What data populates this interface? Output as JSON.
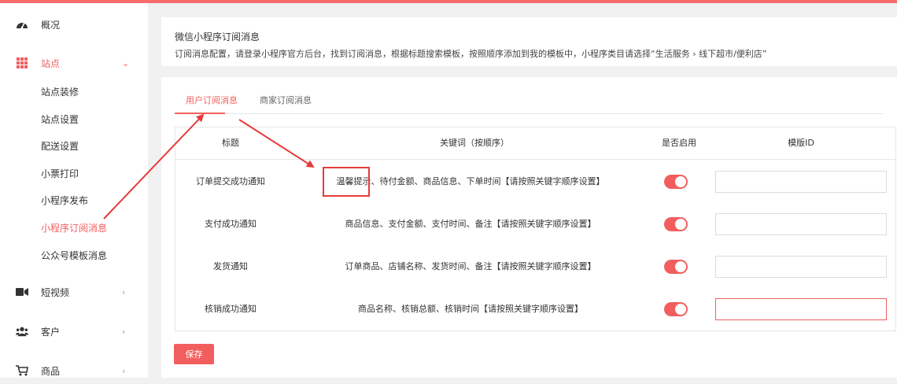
{
  "sidebar": {
    "items": [
      {
        "label": "概况",
        "icon": "dashboard-icon"
      },
      {
        "label": "站点",
        "icon": "grid-icon",
        "chevron": "⌄"
      },
      {
        "label": "短视频",
        "icon": "video-icon",
        "chevron": "›"
      },
      {
        "label": "客户",
        "icon": "users-icon",
        "chevron": "›"
      },
      {
        "label": "商品",
        "icon": "cart-icon",
        "chevron": "›"
      }
    ],
    "sub_items": [
      "站点装修",
      "站点设置",
      "配送设置",
      "小票打印",
      "小程序发布",
      "小程序订阅消息",
      "公众号模板消息"
    ]
  },
  "info": {
    "title": "微信小程序订阅消息",
    "desc": "订阅消息配置，请登录小程序官方后台，找到订阅消息，根据标题搜索模板，按照顺序添加到我的模板中，小程序类目请选择“生活服务 › 线下超市/便利店”"
  },
  "tabs": [
    "用户订阅消息",
    "商家订阅消息"
  ],
  "table": {
    "headers": [
      "标题",
      "关键词（按顺序）",
      "是否启用",
      "模版ID"
    ],
    "rows": [
      {
        "title": "订单提交成功通知",
        "keywords": "温馨提示、待付金额、商品信息、下单时间【请按照关键字顺序设置】",
        "enabled": true,
        "template_id": ""
      },
      {
        "title": "支付成功通知",
        "keywords": "商品信息、支付金额、支付时间、备注【请按照关键字顺序设置】",
        "enabled": true,
        "template_id": ""
      },
      {
        "title": "发货通知",
        "keywords": "订单商品、店铺名称、发货时间、备注【请按照关键字顺序设置】",
        "enabled": true,
        "template_id": ""
      },
      {
        "title": "核销成功通知",
        "keywords": "商品名称、核销总额、核销时间【请按照关键字顺序设置】",
        "enabled": true,
        "template_id": ""
      }
    ]
  },
  "save_label": "保存",
  "colors": {
    "accent": "#f25e5e",
    "annotation": "#e53b3b",
    "topbar": "#f76b6b"
  }
}
